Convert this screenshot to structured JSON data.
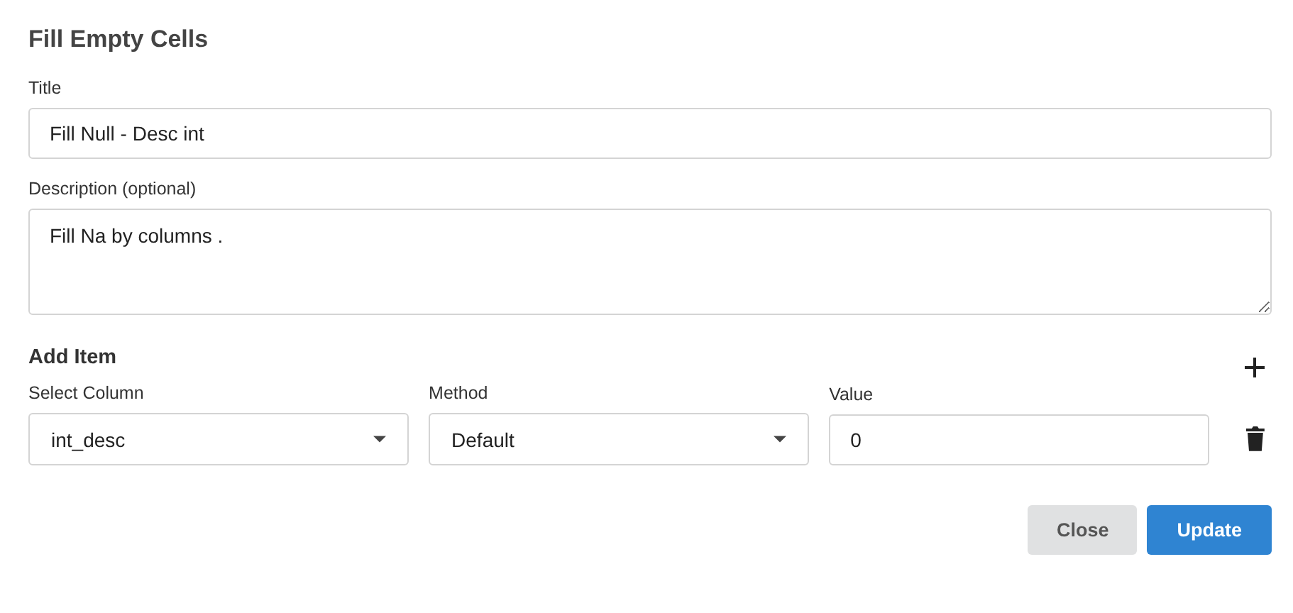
{
  "heading": "Fill Empty Cells",
  "title_field": {
    "label": "Title",
    "value": "Fill Null - Desc int"
  },
  "description_field": {
    "label": "Description (optional)",
    "value": "Fill Na by columns ."
  },
  "add_item": {
    "label": "Add Item"
  },
  "item_fields": [
    {
      "kind": "select",
      "label": "Select Column",
      "value": "int_desc"
    },
    {
      "kind": "select",
      "label": "Method",
      "value": "Default"
    },
    {
      "kind": "input",
      "label": "Value",
      "value": "0"
    }
  ],
  "buttons": [
    {
      "label": "Close",
      "kind": "secondary"
    },
    {
      "label": "Update",
      "kind": "primary"
    }
  ]
}
